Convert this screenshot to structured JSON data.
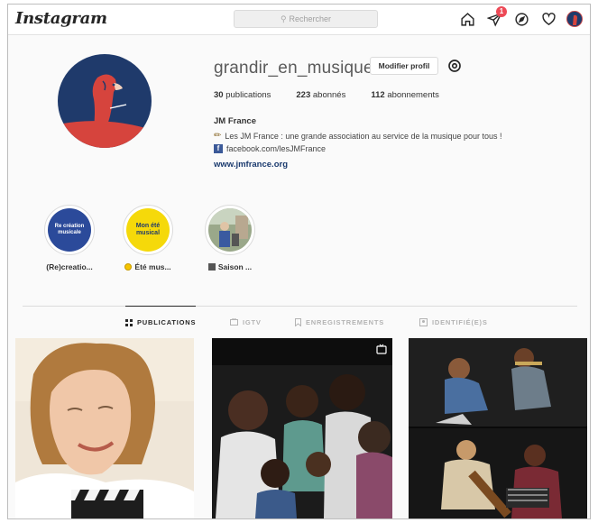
{
  "nav": {
    "logo": "Instagram",
    "search_placeholder": "Rechercher",
    "notifications_count": "1",
    "icons": [
      "home-icon",
      "direct-icon",
      "explore-icon",
      "heart-icon"
    ]
  },
  "profile": {
    "username": "grandir_en_musique",
    "edit_button": "Modifier profil",
    "stats": {
      "posts_count": "30",
      "posts_label": "publications",
      "followers_count": "223",
      "followers_label": "abonnés",
      "following_count": "112",
      "following_label": "abonnements"
    },
    "full_name": "JM France",
    "bio_line1": "Les JM France : une grande association au service de la musique pour tous !",
    "bio_line2": "facebook.com/lesJMFrance",
    "website": "www.jmfrance.org"
  },
  "highlights": [
    {
      "label": "(Re)creatio...",
      "circle_text": "Re création musicale",
      "color": "#2b4a9a"
    },
    {
      "label": "Été mus...",
      "circle_text": "Mon été musical",
      "color": "#f5d90a"
    },
    {
      "label": "Saison ...",
      "circle_text": "",
      "color": "#7a8a6e"
    }
  ],
  "tabs": [
    {
      "label": "PUBLICATIONS",
      "icon": "grid-icon",
      "active": true
    },
    {
      "label": "IGTV",
      "icon": "igtv-icon",
      "active": false
    },
    {
      "label": "ENREGISTREMENTS",
      "icon": "bookmark-icon",
      "active": false
    },
    {
      "label": "IDENTIFIÉ(E)S",
      "icon": "tag-icon",
      "active": false
    }
  ],
  "colors": {
    "accent_blue": "#1a3a6e",
    "notification_red": "#ed4956",
    "avatar_bg": "#1f3a6b",
    "avatar_red": "#d6443d"
  }
}
